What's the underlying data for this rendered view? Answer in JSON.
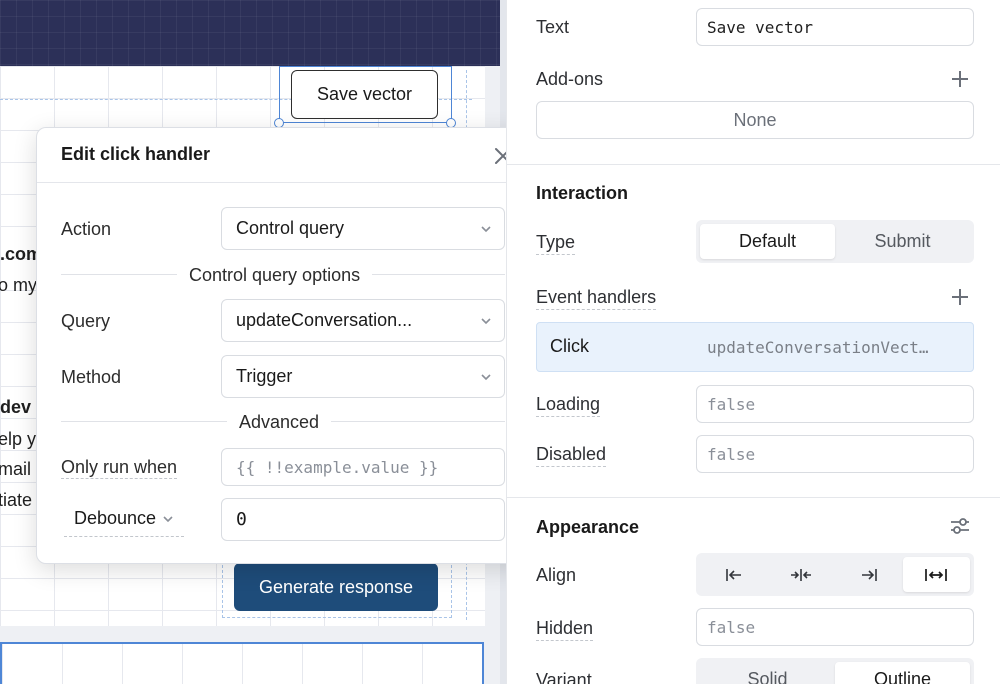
{
  "canvas": {
    "save_vector_label": "Save vector",
    "fragments": [
      ".com",
      "o my",
      "dev",
      "elp y",
      "mail",
      "tiate"
    ],
    "generate_label": "Generate response"
  },
  "modal": {
    "title": "Edit click handler",
    "action": {
      "label": "Action",
      "value": "Control query"
    },
    "control_query_options_label": "Control query options",
    "query": {
      "label": "Query",
      "value": "updateConversation..."
    },
    "method": {
      "label": "Method",
      "value": "Trigger"
    },
    "advanced_label": "Advanced",
    "only_run_when": {
      "label": "Only run when",
      "placeholder": "{{ !!example.value }}"
    },
    "debounce": {
      "label": "Debounce",
      "value": "0"
    }
  },
  "inspector": {
    "text": {
      "label": "Text",
      "value": "Save vector"
    },
    "addons": {
      "label": "Add-ons",
      "value": "None"
    },
    "interaction": {
      "title": "Interaction",
      "type": {
        "label": "Type",
        "options": [
          "Default",
          "Submit"
        ],
        "selected": "Default"
      },
      "event_handlers": {
        "label": "Event handlers",
        "items": [
          {
            "event": "Click",
            "target": "updateConversationVect…"
          }
        ]
      },
      "loading": {
        "label": "Loading",
        "value": "false"
      },
      "disabled": {
        "label": "Disabled",
        "value": "false"
      }
    },
    "appearance": {
      "title": "Appearance",
      "align": {
        "label": "Align",
        "options": [
          "align-left-icon",
          "align-center-icon",
          "align-right-icon",
          "align-stretch-icon"
        ],
        "selected": "align-stretch-icon"
      },
      "hidden": {
        "label": "Hidden",
        "value": "false"
      },
      "variant": {
        "label": "Variant",
        "options": [
          "Solid",
          "Outline"
        ],
        "selected": "Outline"
      }
    }
  }
}
